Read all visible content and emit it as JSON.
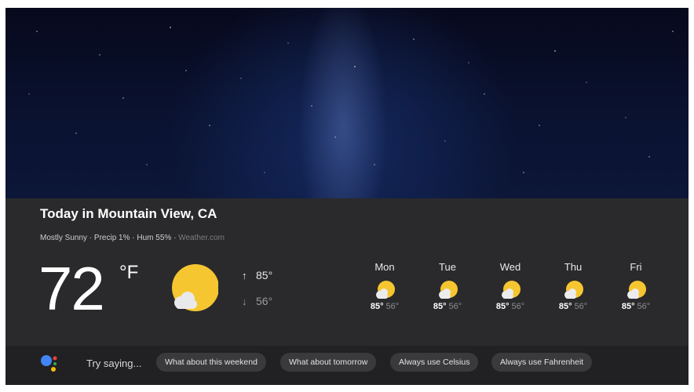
{
  "header": {
    "title": "Today in Mountain View, CA",
    "condition": "Mostly Sunny",
    "precip": "Precip 1%",
    "humidity": "Hum 55%",
    "separator": " · ",
    "source": "Weather.com"
  },
  "current": {
    "temperature": "72",
    "unit": "°F",
    "icon": "partly-sunny-icon",
    "high": "85°",
    "low": "56°"
  },
  "forecast": [
    {
      "day": "Mon",
      "high": "85°",
      "low": "56°",
      "icon": "partly-sunny-icon"
    },
    {
      "day": "Tue",
      "high": "85°",
      "low": "56°",
      "icon": "partly-sunny-icon"
    },
    {
      "day": "Wed",
      "high": "85°",
      "low": "56°",
      "icon": "partly-sunny-icon"
    },
    {
      "day": "Thu",
      "high": "85°",
      "low": "56°",
      "icon": "partly-sunny-icon"
    },
    {
      "day": "Fri",
      "high": "85°",
      "low": "56°",
      "icon": "partly-sunny-icon"
    }
  ],
  "suggestions": {
    "prompt": "Try saying...",
    "chips": [
      "What about this weekend",
      "What about tomorrow",
      "Always use Celsius",
      "Always use Fahrenheit"
    ]
  },
  "colors": {
    "sun": "#f6c630",
    "panel": "#2a2a2c",
    "bar": "#212123",
    "assistant": [
      "#4285f4",
      "#ea4335",
      "#fbbc05",
      "#34a853"
    ]
  }
}
